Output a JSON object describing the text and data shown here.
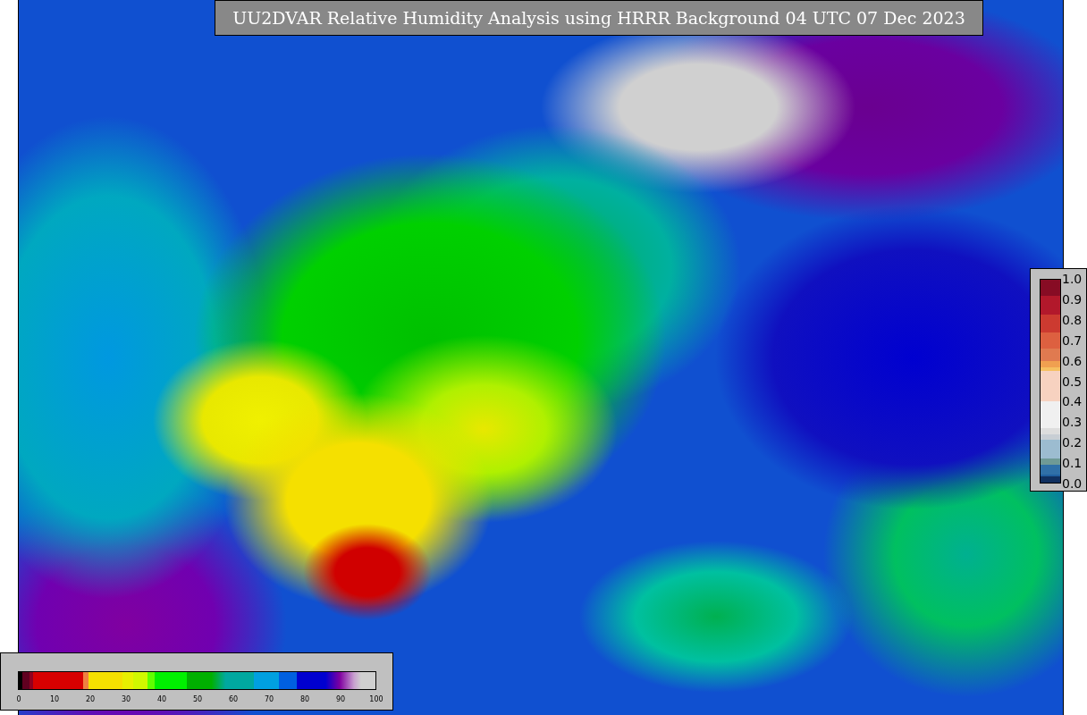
{
  "title": "UU2DVAR Relative Humidity Analysis using HRRR Background 04 UTC 07 Dec 2023",
  "right_colorbar": {
    "ticks": [
      "1.0",
      "0.9",
      "0.8",
      "0.7",
      "0.6",
      "0.5",
      "0.4",
      "0.3",
      "0.2",
      "0.1",
      "0.0"
    ]
  },
  "bottom_colorbar": {
    "ticks": [
      "0",
      "10",
      "20",
      "30",
      "40",
      "50",
      "60",
      "70",
      "80",
      "90",
      "100"
    ]
  }
}
